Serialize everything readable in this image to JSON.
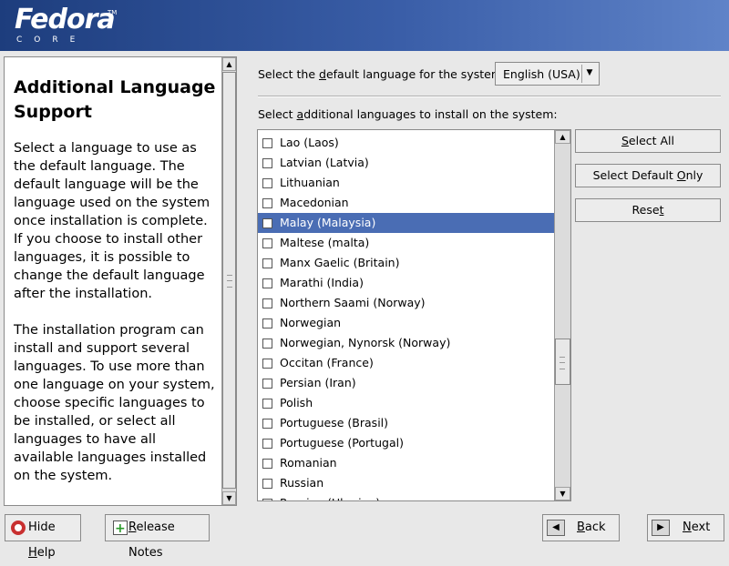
{
  "banner": {
    "brand": "Fedora",
    "sub": "CORE",
    "tm": "TM"
  },
  "help": {
    "title": "Additional Language Support",
    "paragraphs": [
      "Select a language to use as the default language. The default language will be the language used on the system once installation is complete. If you choose to install other languages, it is possible to change the default language after the installation.",
      "The installation program can install and support several languages. To use more than one language on your system, choose specific languages to be installed, or select all languages to have all available languages installed on the system."
    ]
  },
  "default_lang": {
    "label_pre": "Select the ",
    "label_u": "d",
    "label_post": "efault language for the system:",
    "value": "English (USA)"
  },
  "additional": {
    "label_pre": "Select ",
    "label_u": "a",
    "label_post": "dditional languages to install on the system:"
  },
  "languages": [
    "Lao (Laos)",
    "Latvian (Latvia)",
    "Lithuanian",
    "Macedonian",
    "Malay (Malaysia)",
    "Maltese (malta)",
    "Manx Gaelic (Britain)",
    "Marathi (India)",
    "Northern Saami (Norway)",
    "Norwegian",
    "Norwegian, Nynorsk (Norway)",
    "Occitan (France)",
    "Persian (Iran)",
    "Polish",
    "Portuguese (Brasil)",
    "Portuguese (Portugal)",
    "Romanian",
    "Russian",
    "Russian (Ukraine)"
  ],
  "selected_index": 4,
  "buttons": {
    "select_all": {
      "pre": "",
      "u": "S",
      "post": "elect All"
    },
    "select_default": {
      "pre": "Select Default ",
      "u": "O",
      "post": "nly"
    },
    "reset": {
      "pre": "Rese",
      "u": "t",
      "post": ""
    }
  },
  "bottom": {
    "hide_help": {
      "pre": "Hide ",
      "u": "H",
      "post": "elp"
    },
    "release_notes": {
      "pre": "",
      "u": "R",
      "post": "elease Notes"
    },
    "back": {
      "pre": "",
      "u": "B",
      "post": "ack"
    },
    "next": {
      "pre": "",
      "u": "N",
      "post": "ext"
    }
  },
  "icons": {
    "lifebuoy": "lifebuoy-icon",
    "notes": "notes-icon",
    "back": "back-arrow-icon",
    "next": "next-arrow-icon"
  }
}
